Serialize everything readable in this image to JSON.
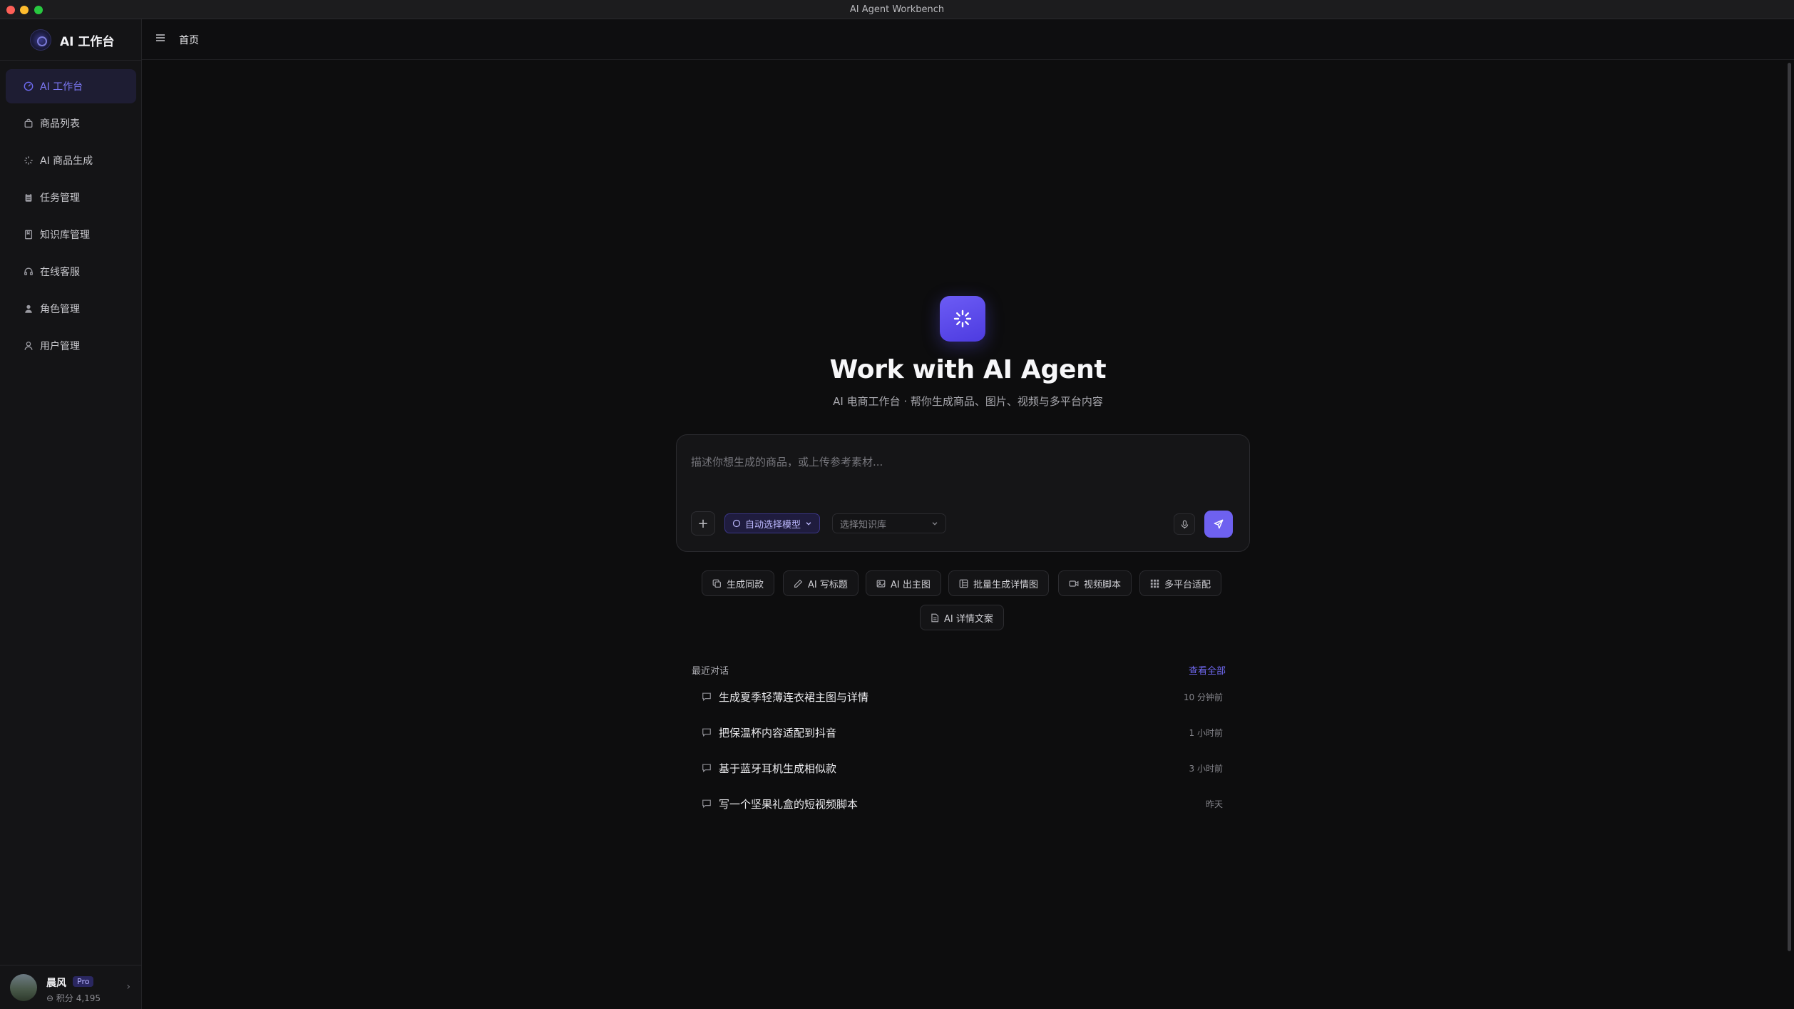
{
  "window": {
    "title": "AI Agent Workbench"
  },
  "brand": {
    "title": "AI 工作台"
  },
  "sidebar": {
    "items": [
      {
        "label": "AI 工作台",
        "icon": "dashboard-icon",
        "active": true
      },
      {
        "label": "商品列表",
        "icon": "shopping-bag-icon",
        "active": false
      },
      {
        "label": "AI 商品生成",
        "icon": "sparkles-icon",
        "active": false
      },
      {
        "label": "任务管理",
        "icon": "clipboard-icon",
        "active": false
      },
      {
        "label": "知识库管理",
        "icon": "book-icon",
        "active": false
      },
      {
        "label": "在线客服",
        "icon": "headset-icon",
        "active": false
      },
      {
        "label": "角色管理",
        "icon": "user-role-icon",
        "active": false
      },
      {
        "label": "用户管理",
        "icon": "user-icon",
        "active": false
      }
    ]
  },
  "user": {
    "name": "晨风",
    "badge": "Pro",
    "points": "积分 4,195"
  },
  "header": {
    "breadcrumb": "首页"
  },
  "hero": {
    "title": "Work with AI Agent",
    "subtitle": "AI 电商工作台 · 帮你生成商品、图片、视频与多平台内容"
  },
  "composer": {
    "placeholder": "描述你想生成的商品，或上传参考素材...",
    "model_label": "自动选择模型",
    "kb_placeholder": "选择知识库"
  },
  "quick_actions": [
    {
      "label": "生成同款",
      "icon": "copy-icon"
    },
    {
      "label": "AI 写标题",
      "icon": "pen-icon"
    },
    {
      "label": "AI 出主图",
      "icon": "image-icon"
    },
    {
      "label": "批量生成详情图",
      "icon": "layout-icon"
    },
    {
      "label": "视频脚本",
      "icon": "video-icon"
    },
    {
      "label": "多平台适配",
      "icon": "grid-icon"
    },
    {
      "label": "AI 详情文案",
      "icon": "document-icon"
    }
  ],
  "recent": {
    "heading": "最近对话",
    "view_all": "查看全部",
    "items": [
      {
        "title": "生成夏季轻薄连衣裙主图与详情",
        "time": "10 分钟前"
      },
      {
        "title": "把保温杯内容适配到抖音",
        "time": "1 小时前"
      },
      {
        "title": "基于蓝牙耳机生成相似款",
        "time": "3 小时前"
      },
      {
        "title": "写一个坚果礼盒的短视频脚本",
        "time": "昨天"
      }
    ]
  },
  "colors": {
    "accent": "#6e61f0",
    "active_nav_bg": "#1e1d33",
    "background": "#0d0d0e"
  }
}
